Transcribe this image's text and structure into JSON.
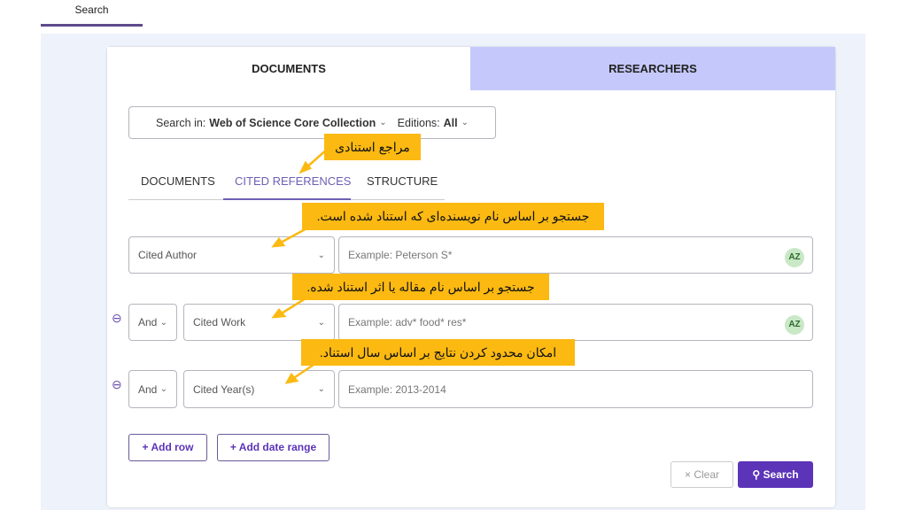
{
  "top_tab": "Search",
  "main_tabs": [
    {
      "label": "DOCUMENTS",
      "active": true
    },
    {
      "label": "RESEARCHERS",
      "active": false
    }
  ],
  "search_in": {
    "label": "Search in:",
    "value": "Web of Science Core Collection",
    "editions_label": "Editions:",
    "editions_value": "All"
  },
  "sub_tabs": [
    {
      "label": "DOCUMENTS"
    },
    {
      "label": "CITED REFERENCES",
      "active": true
    },
    {
      "label": "STRUCTURE"
    }
  ],
  "rows": [
    {
      "field": "Cited Author",
      "placeholder": "Example: Peterson S*",
      "az": "AZ"
    },
    {
      "operator": "And",
      "field": "Cited Work",
      "placeholder": "Example: adv* food* res*",
      "az": "AZ"
    },
    {
      "operator": "And",
      "field": "Cited Year(s)",
      "placeholder": "Example: 2013-2014"
    }
  ],
  "callouts": [
    "مراجع استنادی",
    "جستجو بر اساس نام نویسنده‌ای که استناد شده است.",
    "جستجو بر اساس نام مقاله یا اثر استناد شده.",
    "امکان محدود کردن نتایج بر اساس سال استناد."
  ],
  "buttons": {
    "add_row": "+ Add row",
    "add_date_range": "+ Add date range",
    "clear": "× Clear",
    "search": "Search"
  },
  "colors": {
    "accent": "#5b34b8",
    "callout": "#fbb912",
    "researchers_tab": "#c5c8fb",
    "active_subtab": "#6e5fb5"
  }
}
